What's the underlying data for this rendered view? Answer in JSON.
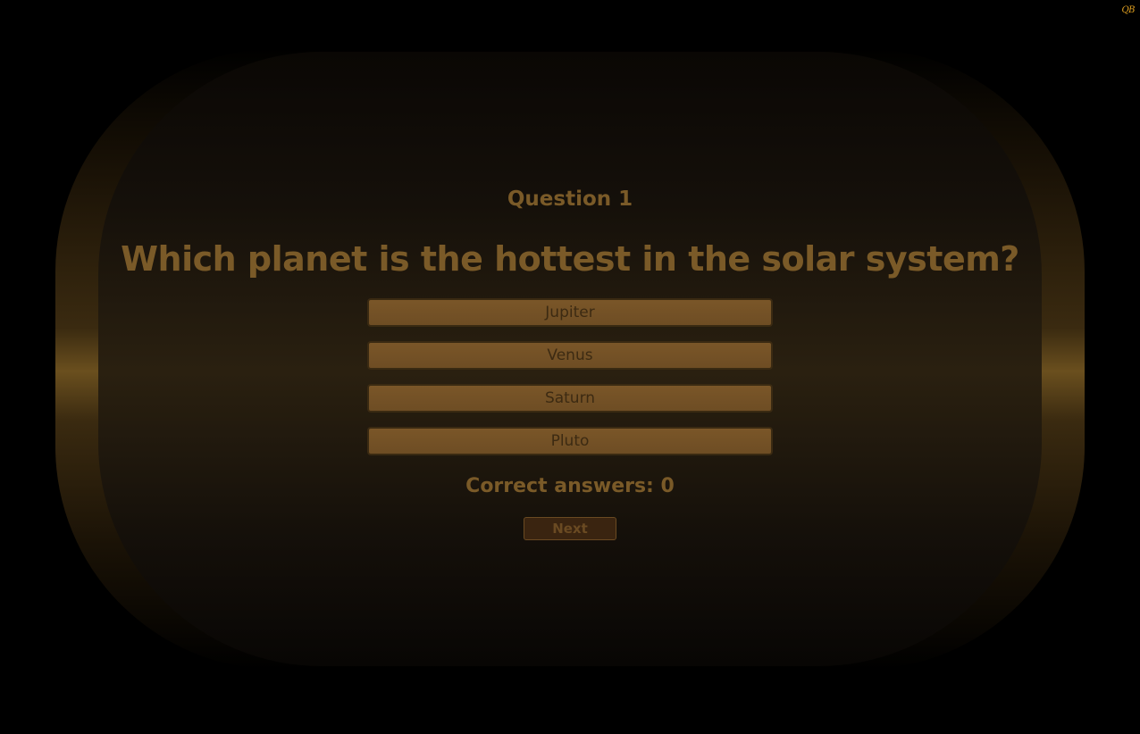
{
  "badge": {
    "text": "QB"
  },
  "quiz": {
    "question_number": "Question 1",
    "question_text": "Which planet is the hottest in the solar system?",
    "answers": [
      {
        "label": "Jupiter"
      },
      {
        "label": "Venus"
      },
      {
        "label": "Saturn"
      },
      {
        "label": "Pluto"
      }
    ],
    "score_text": "Correct answers: 0",
    "next_label": "Next"
  },
  "colors": {
    "background": "#000000",
    "frame_gold": "#6a4f1e",
    "text_accent": "#7a5a28",
    "button_fill": "#7a5628",
    "button_text": "#3c2a12",
    "next_fill": "#3a2410",
    "badge_gold": "#e0a020"
  }
}
